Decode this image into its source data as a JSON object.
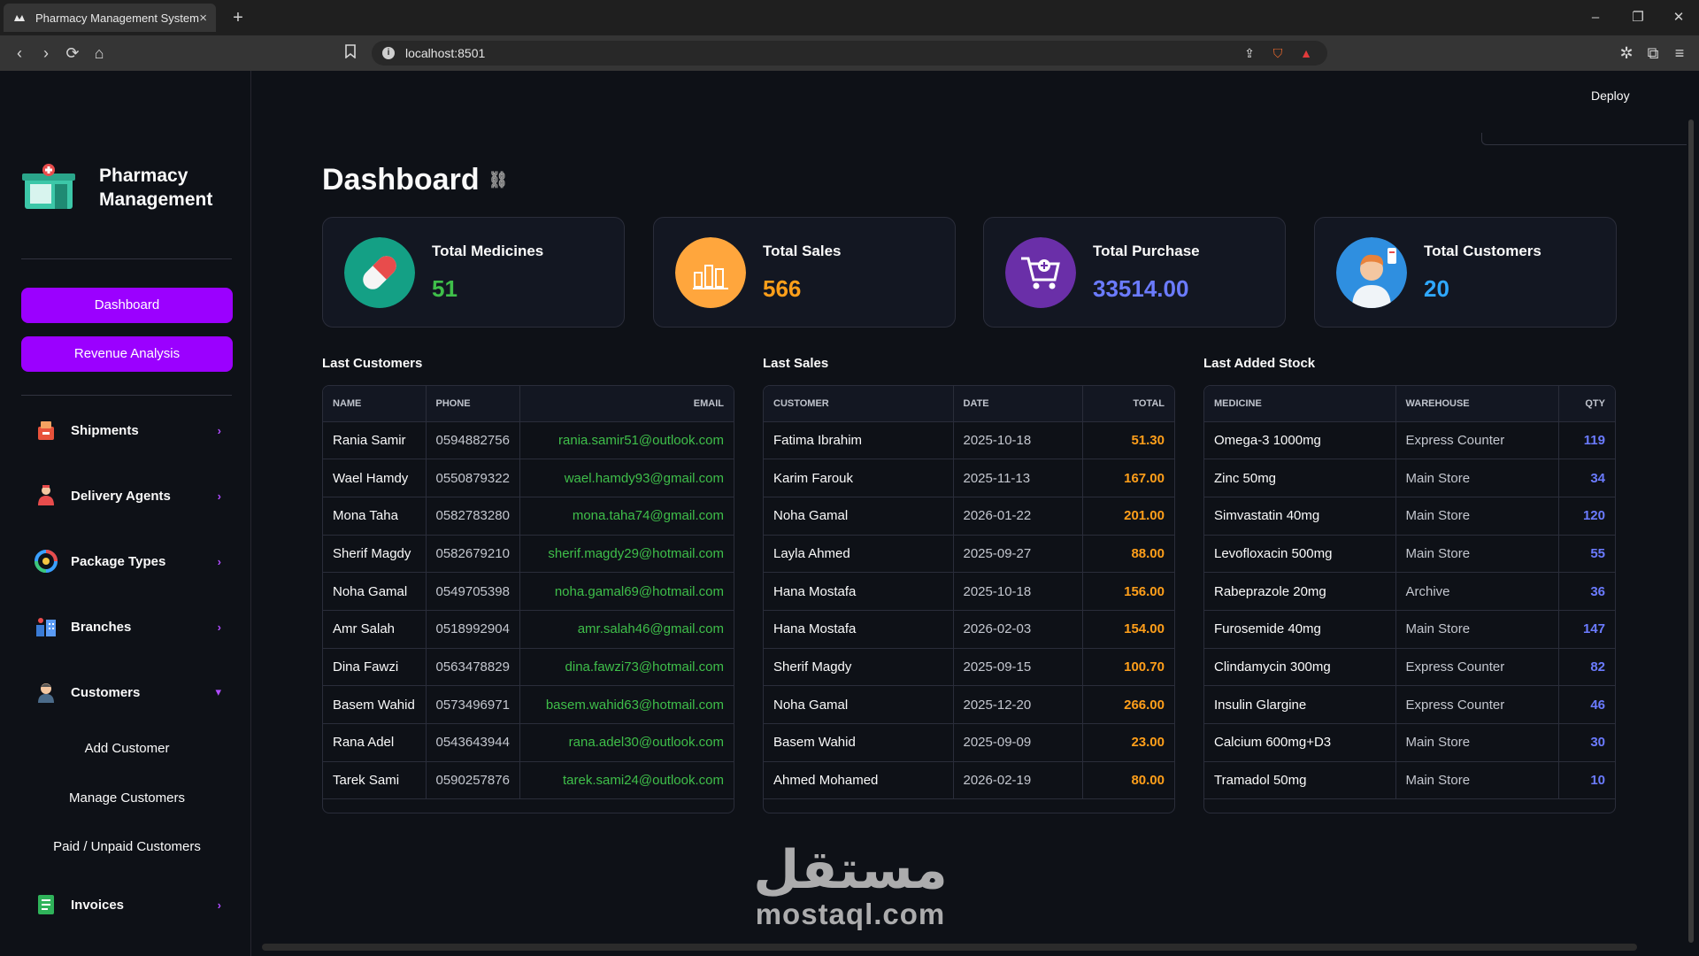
{
  "browser": {
    "tab_title": "Pharmacy Management System",
    "url": "localhost:8501",
    "new_tab": "+",
    "close_tab": "×",
    "minimize": "–",
    "restore": "❐",
    "close_window": "✕"
  },
  "app": {
    "deploy_label": "Deploy",
    "brand_title": "Pharmacy Management",
    "sidebar": {
      "buttons": [
        "Dashboard",
        "Revenue Analysis"
      ],
      "nav": [
        {
          "label": "Shipments",
          "chevron": "›"
        },
        {
          "label": "Delivery Agents",
          "chevron": "›"
        },
        {
          "label": "Package Types",
          "chevron": "›"
        },
        {
          "label": "Branches",
          "chevron": "›"
        },
        {
          "label": "Customers",
          "chevron": "▾"
        },
        {
          "label": "Invoices",
          "chevron": "›"
        }
      ],
      "customer_sub": [
        "Add Customer",
        "Manage Customers",
        "Paid / Unpaid Customers"
      ]
    },
    "page_title": "Dashboard",
    "cards": [
      {
        "label": "Total Medicines",
        "value": "51",
        "color": "#3fbf4a"
      },
      {
        "label": "Total Sales",
        "value": "566",
        "color": "#ff9f1a"
      },
      {
        "label": "Total Purchase",
        "value": "33514.00",
        "color": "#6b7bff"
      },
      {
        "label": "Total Customers",
        "value": "20",
        "color": "#2fa8ff"
      }
    ],
    "sections": [
      "Last Customers",
      "Last Sales",
      "Last Added Stock"
    ],
    "customers": {
      "headers": [
        "NAME",
        "PHONE",
        "EMAIL"
      ],
      "rows": [
        [
          "Rania Samir",
          "0594882756",
          "rania.samir51@outlook.com"
        ],
        [
          "Wael Hamdy",
          "0550879322",
          "wael.hamdy93@gmail.com"
        ],
        [
          "Mona Taha",
          "0582783280",
          "mona.taha74@gmail.com"
        ],
        [
          "Sherif Magdy",
          "0582679210",
          "sherif.magdy29@hotmail.com"
        ],
        [
          "Noha Gamal",
          "0549705398",
          "noha.gamal69@hotmail.com"
        ],
        [
          "Amr Salah",
          "0518992904",
          "amr.salah46@gmail.com"
        ],
        [
          "Dina Fawzi",
          "0563478829",
          "dina.fawzi73@hotmail.com"
        ],
        [
          "Basem Wahid",
          "0573496971",
          "basem.wahid63@hotmail.com"
        ],
        [
          "Rana Adel",
          "0543643944",
          "rana.adel30@outlook.com"
        ],
        [
          "Tarek Sami",
          "0590257876",
          "tarek.sami24@outlook.com"
        ]
      ]
    },
    "sales": {
      "headers": [
        "CUSTOMER",
        "DATE",
        "TOTAL"
      ],
      "rows": [
        [
          "Fatima Ibrahim",
          "2025-10-18",
          "51.30"
        ],
        [
          "Karim Farouk",
          "2025-11-13",
          "167.00"
        ],
        [
          "Noha Gamal",
          "2026-01-22",
          "201.00"
        ],
        [
          "Layla Ahmed",
          "2025-09-27",
          "88.00"
        ],
        [
          "Hana Mostafa",
          "2025-10-18",
          "156.00"
        ],
        [
          "Hana Mostafa",
          "2026-02-03",
          "154.00"
        ],
        [
          "Sherif Magdy",
          "2025-09-15",
          "100.70"
        ],
        [
          "Noha Gamal",
          "2025-12-20",
          "266.00"
        ],
        [
          "Basem Wahid",
          "2025-09-09",
          "23.00"
        ],
        [
          "Ahmed Mohamed",
          "2026-02-19",
          "80.00"
        ]
      ]
    },
    "stock": {
      "headers": [
        "MEDICINE",
        "WAREHOUSE",
        "QTY"
      ],
      "rows": [
        [
          "Omega-3 1000mg",
          "Express Counter",
          "119"
        ],
        [
          "Zinc 50mg",
          "Main Store",
          "34"
        ],
        [
          "Simvastatin 40mg",
          "Main Store",
          "120"
        ],
        [
          "Levofloxacin 500mg",
          "Main Store",
          "55"
        ],
        [
          "Rabeprazole 20mg",
          "Archive",
          "36"
        ],
        [
          "Furosemide 40mg",
          "Main Store",
          "147"
        ],
        [
          "Clindamycin 300mg",
          "Express Counter",
          "82"
        ],
        [
          "Insulin Glargine",
          "Express Counter",
          "46"
        ],
        [
          "Calcium 600mg+D3",
          "Main Store",
          "30"
        ],
        [
          "Tramadol 50mg",
          "Main Store",
          "10"
        ]
      ]
    },
    "watermark": {
      "arabic": "مستقل",
      "latin": "mostaql.com"
    }
  }
}
